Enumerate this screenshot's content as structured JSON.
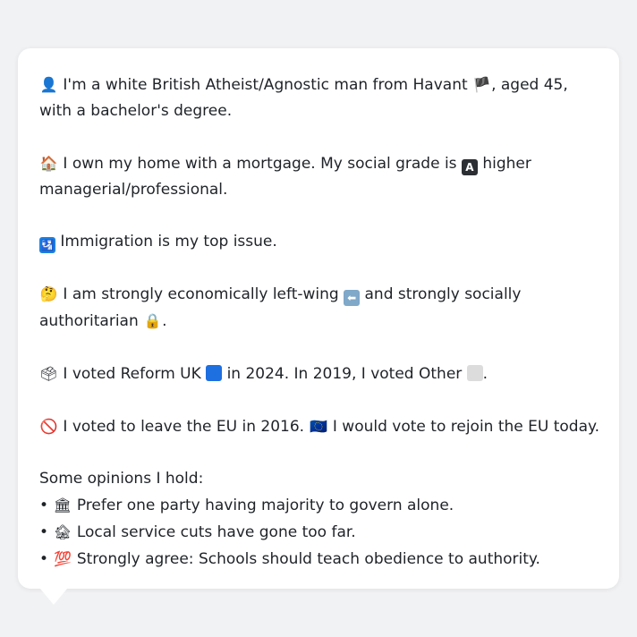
{
  "p1": {
    "icon": "👤",
    "text_a": "I'm a white British Atheist/Agnostic man from Havant",
    "flag": "🏴",
    "text_b": ", aged 45, with a bachelor's degree."
  },
  "p2": {
    "icon": "🏠",
    "text_a": "I own my home with a mortgage. My social grade is",
    "grade_badge": "A",
    "text_b": "higher managerial/professional."
  },
  "p3": {
    "icon": "🛂",
    "text": "Immigration is my top issue."
  },
  "p4": {
    "icon": "🤔",
    "text_a": "I am strongly economically left-wing",
    "arrow": "⬅",
    "text_b": "and strongly socially authoritarian",
    "lock": "🔒",
    "text_c": "."
  },
  "p5": {
    "icon": "🗳",
    "text_a": "I voted Reform UK",
    "text_b": "in 2024. In 2019, I voted Other",
    "text_c": ".",
    "reform_color": "#1e6fe0",
    "other_color": "#dcdcdc"
  },
  "p6": {
    "icon": "🚫",
    "text_a": "I voted to leave the EU in 2016.",
    "eu_flag": "🇪🇺",
    "text_b": "I would vote to rejoin the EU today."
  },
  "opinions": {
    "heading": "Some opinions I hold:",
    "items": [
      {
        "bullet": "•",
        "icon": "🏛",
        "text": "Prefer one party having majority to govern alone."
      },
      {
        "bullet": "•",
        "icon": "🏚",
        "text": "Local service cuts have gone too far."
      },
      {
        "bullet": "•",
        "icon": "💯",
        "text": "Strongly agree: Schools should teach obedience to authority."
      }
    ]
  }
}
